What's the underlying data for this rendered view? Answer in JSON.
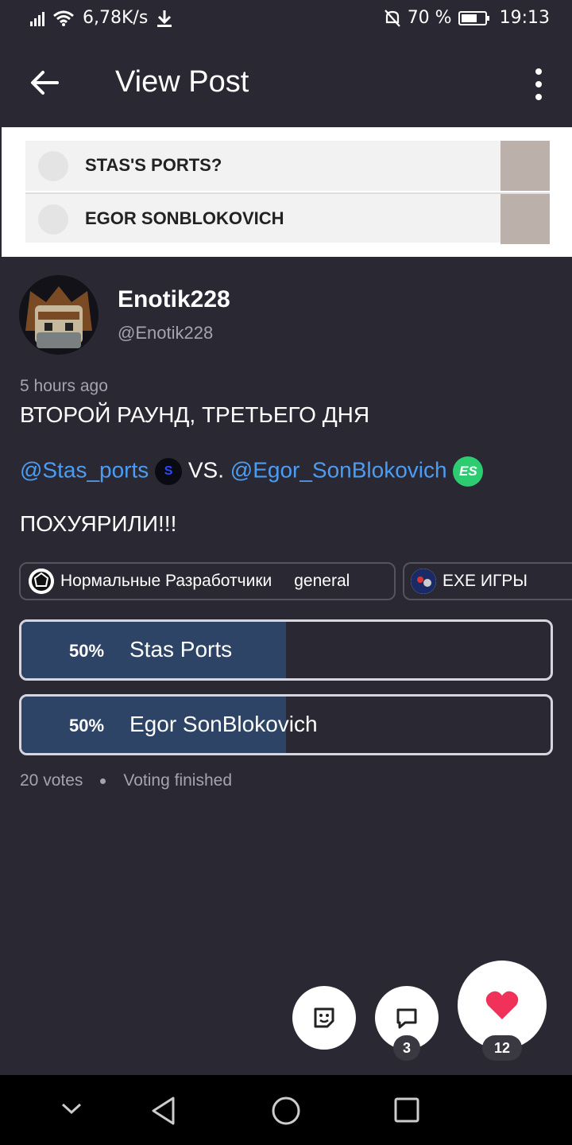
{
  "status_bar": {
    "net_speed": "6,78K/s",
    "battery_percent": "70 %",
    "battery_level": 0.7,
    "time": "19:13",
    "icons": [
      "signal-icon",
      "wifi-icon",
      "download-icon",
      "mute-icon",
      "battery-icon"
    ]
  },
  "app_bar": {
    "title": "View Post"
  },
  "preview": {
    "items": [
      {
        "name": "STAS'S PORTS?"
      },
      {
        "name": "EGOR SONBLOKOVICH"
      }
    ]
  },
  "author": {
    "name": "Enotik228",
    "handle": "@Enotik228"
  },
  "post": {
    "time_ago": "5 hours ago",
    "line1": "ВТОРОЙ РАУНД, ТРЕТЬЕГО ДНЯ",
    "mention1": "@Stas_ports",
    "emoji1": "S",
    "vs": "VS.",
    "mention2": "@Egor_SonBlokovich",
    "emoji2": "ES",
    "line3": "ПОХУЯРИЛИ!!!"
  },
  "chips": [
    {
      "community": "Нормальные Разработчики",
      "channel": "general"
    },
    {
      "community": "EXE ИГРЫ"
    }
  ],
  "poll": {
    "options": [
      {
        "percent": "50%",
        "label": "Stas Ports",
        "share": 0.5
      },
      {
        "percent": "50%",
        "label": "Egor SonBlokovich",
        "share": 0.5
      }
    ],
    "votes": "20 votes",
    "status": "Voting finished"
  },
  "actions": {
    "comments_count": "3",
    "likes_count": "12"
  },
  "colors": {
    "background": "#2a2833",
    "mention": "#4b9cf3",
    "poll_fill": "#2e4466",
    "like": "#f0325a"
  }
}
